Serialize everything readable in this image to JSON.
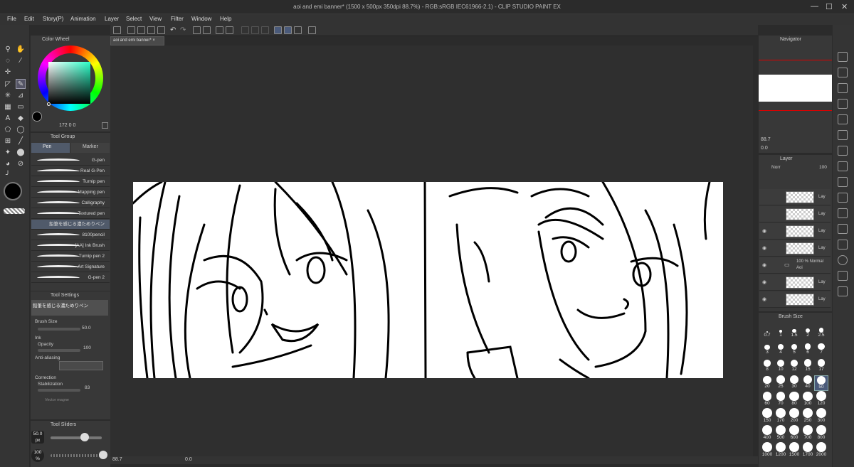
{
  "app": {
    "title": "aoi and emi banner* (1500 x 500px 350dpi 88.7%) - RGB:sRGB IEC61966-2.1) - CLIP STUDIO PAINT EX"
  },
  "menu": [
    "File",
    "Edit",
    "Story(P)",
    "Animation",
    "Layer",
    "Select",
    "View",
    "Filter",
    "Window",
    "Help"
  ],
  "doc_tab": {
    "label": "aoi and emi banner*",
    "close": "×"
  },
  "color_wheel": {
    "title": "Color Wheel",
    "readout": "172 0 0",
    "main_color": "#000000",
    "sub_color": "#ffffff"
  },
  "tool_group": {
    "title": "Tool Group",
    "tabs": [
      "Pen",
      "Marker"
    ],
    "brushes": [
      "G-pen",
      "Real G-Pen",
      "Turnip pen",
      "Mapping pen",
      "Calligraphy",
      "Textured pen",
      "鉛筆を感じる濃ためりペン",
      "8100pencil",
      "[AA] Ink Brush",
      "Turnip pen 2",
      "Art Signature",
      "G-pen 2"
    ]
  },
  "tool_settings": {
    "title": "Tool Settings",
    "current_brush": "鉛筆を感じる濃ためりペン",
    "brush_size_label": "Brush Size",
    "brush_size_value": "50.0",
    "ink_label": "Ink",
    "opacity_label": "Opacity",
    "opacity_value": "100",
    "anti_aliasing_label": "Anti-aliasing",
    "correction_label": "Correction",
    "stabilization_label": "Stabilization",
    "stabilization_value": "83",
    "vector_magnet_label": "Vector magne"
  },
  "tool_sliders": {
    "title": "Tool Sliders",
    "size_value": "50.0",
    "size_unit": "px",
    "opacity_value": "100",
    "opacity_unit": "%"
  },
  "navigator": {
    "title": "Navigator",
    "zoom": "88.7",
    "rotation": "0.0"
  },
  "layer": {
    "title": "Layer",
    "blend_mode": "Norr",
    "opacity": "100",
    "rows": [
      {
        "label": "Lay",
        "folder": false
      },
      {
        "label": "Lay",
        "folder": false
      },
      {
        "label": "Lay",
        "folder": false
      },
      {
        "label": "Lay",
        "folder": false
      },
      {
        "label": "100 % Normal",
        "sublabel": "Aoi",
        "folder": true
      },
      {
        "label": "Lay",
        "folder": false
      },
      {
        "label": "Lay",
        "folder": false
      }
    ]
  },
  "brush_size": {
    "title": "Brush Size",
    "sizes": [
      "0.7",
      "1",
      "1.5",
      "2",
      "2.5",
      "3",
      "4",
      "5",
      "6",
      "7",
      "8",
      "10",
      "12",
      "15",
      "17",
      "20",
      "25",
      "30",
      "40",
      "50",
      "60",
      "70",
      "80",
      "100",
      "120",
      "150",
      "170",
      "200",
      "250",
      "300",
      "400",
      "500",
      "600",
      "700",
      "800",
      "1000",
      "1200",
      "1500",
      "1700",
      "2000"
    ],
    "selected": "50"
  },
  "status": {
    "zoom": "88.7",
    "rotation": "0.0"
  }
}
